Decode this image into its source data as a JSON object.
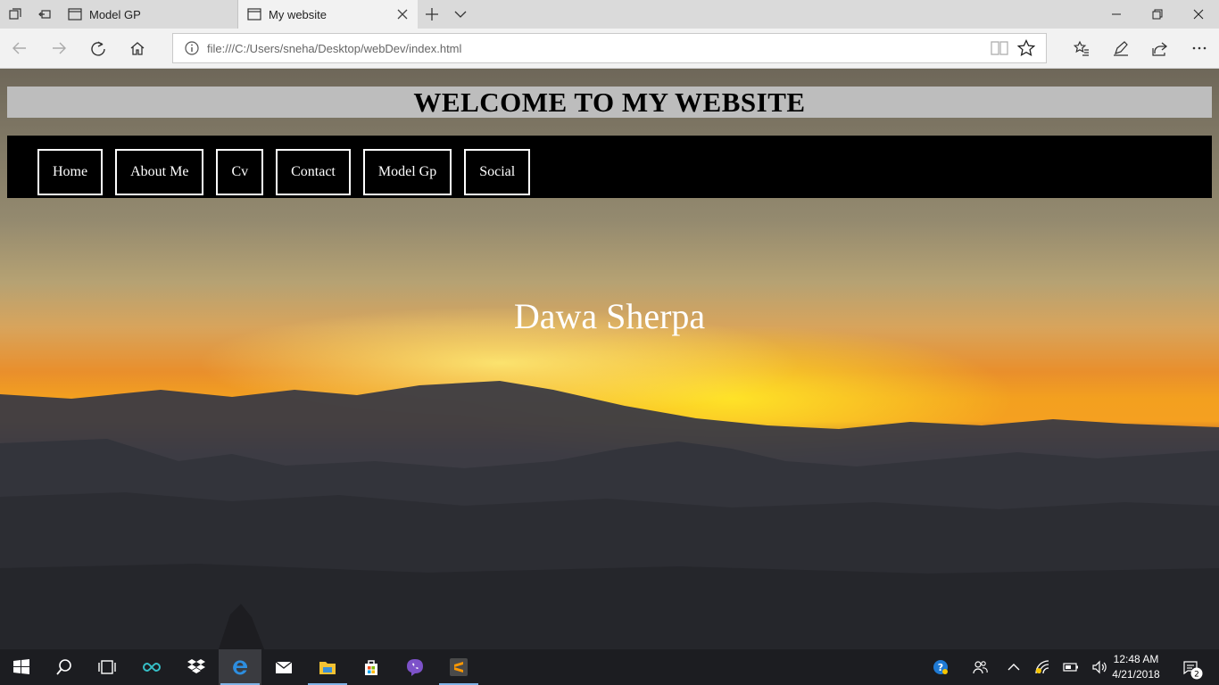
{
  "browser": {
    "tabs": [
      {
        "title": "Model GP",
        "active": false
      },
      {
        "title": "My website",
        "active": true
      }
    ],
    "address": "file:///C:/Users/sneha/Desktop/webDev/index.html"
  },
  "site": {
    "header": "WELCOME TO MY WEBSITE",
    "nav": [
      {
        "label": "Home"
      },
      {
        "label": "About Me"
      },
      {
        "label": "Cv"
      },
      {
        "label": "Contact"
      },
      {
        "label": "Model Gp"
      },
      {
        "label": "Social"
      }
    ],
    "hero_name": "Dawa Sherpa"
  },
  "taskbar": {
    "time": "12:48 AM",
    "date": "4/21/2018",
    "notifications": "2"
  },
  "colors": {
    "nav_bg": "#000000",
    "header_bg": "#bdbdbd",
    "sunset": "#f5a020"
  },
  "icons": [
    "windows-start-icon",
    "search-icon",
    "task-view-icon",
    "infinity-app-icon",
    "dropbox-icon",
    "edge-icon",
    "mail-icon",
    "file-explorer-icon",
    "store-icon",
    "viber-icon",
    "sublime-text-icon"
  ]
}
